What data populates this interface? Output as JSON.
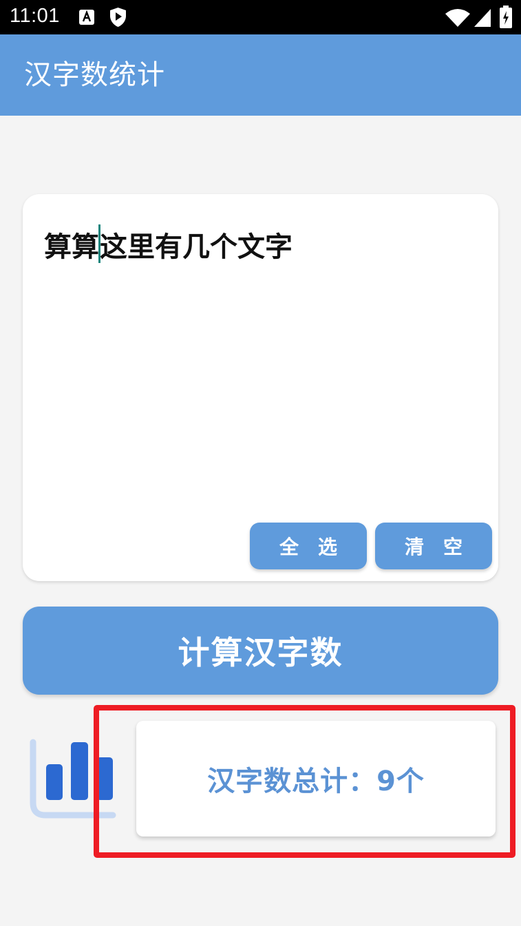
{
  "status_bar": {
    "time": "11:01"
  },
  "app_bar": {
    "title": "汉字数统计"
  },
  "editor": {
    "text_before_cursor": "算算",
    "text_after_cursor": "这里有几个文字"
  },
  "buttons": {
    "select_all": "全选",
    "clear": "清空",
    "calculate": "计算汉字数"
  },
  "result": {
    "text": "汉字数总计：9个"
  },
  "colors": {
    "primary": "#5f9bdc",
    "result_text": "#5b92d4",
    "highlight_border": "#ee1c24",
    "cursor": "#17857d"
  },
  "icons": {
    "status": [
      "a-notification-icon",
      "shield-play-icon",
      "wifi-icon",
      "signal-icon",
      "battery-icon"
    ],
    "result": "bar-chart-icon"
  }
}
